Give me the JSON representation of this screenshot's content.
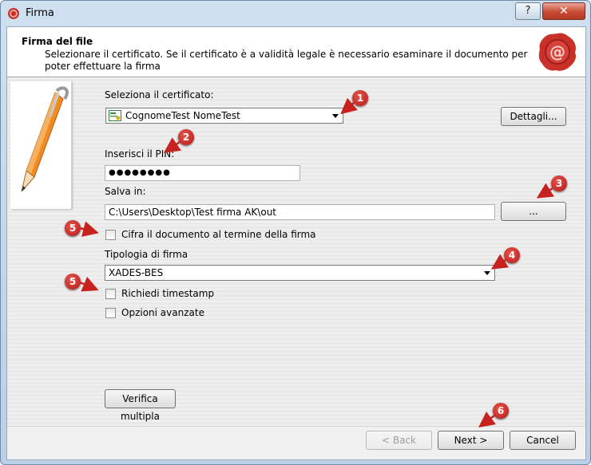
{
  "window": {
    "title": "Firma",
    "help_label": "?",
    "close_label": "✕"
  },
  "header": {
    "title": "Firma del file",
    "description": "Selezionare il certificato. Se il certificato è a validità legale è necessario esaminare il documento per poter effettuare la firma"
  },
  "form": {
    "cert_label": "Seleziona il certificato:",
    "cert_value": "CognomeTest NomeTest",
    "details_button": "Dettagli...",
    "pin_label": "Inserisci il PIN:",
    "pin_value": "●●●●●●●●",
    "save_label": "Salva in:",
    "save_value": "C:\\Users\\Desktop\\Test firma AK\\out",
    "browse_button": "...",
    "encrypt_label": "Cifra il documento al termine della firma",
    "type_label": "Tipologia di firma",
    "type_value": "XADES-BES",
    "timestamp_label": "Richiedi timestamp",
    "advanced_label": "Opzioni avanzate",
    "multi_verify_button": "Verifica multipla"
  },
  "footer": {
    "back_button": "< Back",
    "next_button": "Next >",
    "cancel_button": "Cancel"
  },
  "markers": [
    "1",
    "2",
    "3",
    "4",
    "5",
    "5",
    "6"
  ],
  "colors": {
    "marker_red": "#c8221e",
    "seal_red": "#c9302a",
    "pen_orange": "#f08a24"
  }
}
